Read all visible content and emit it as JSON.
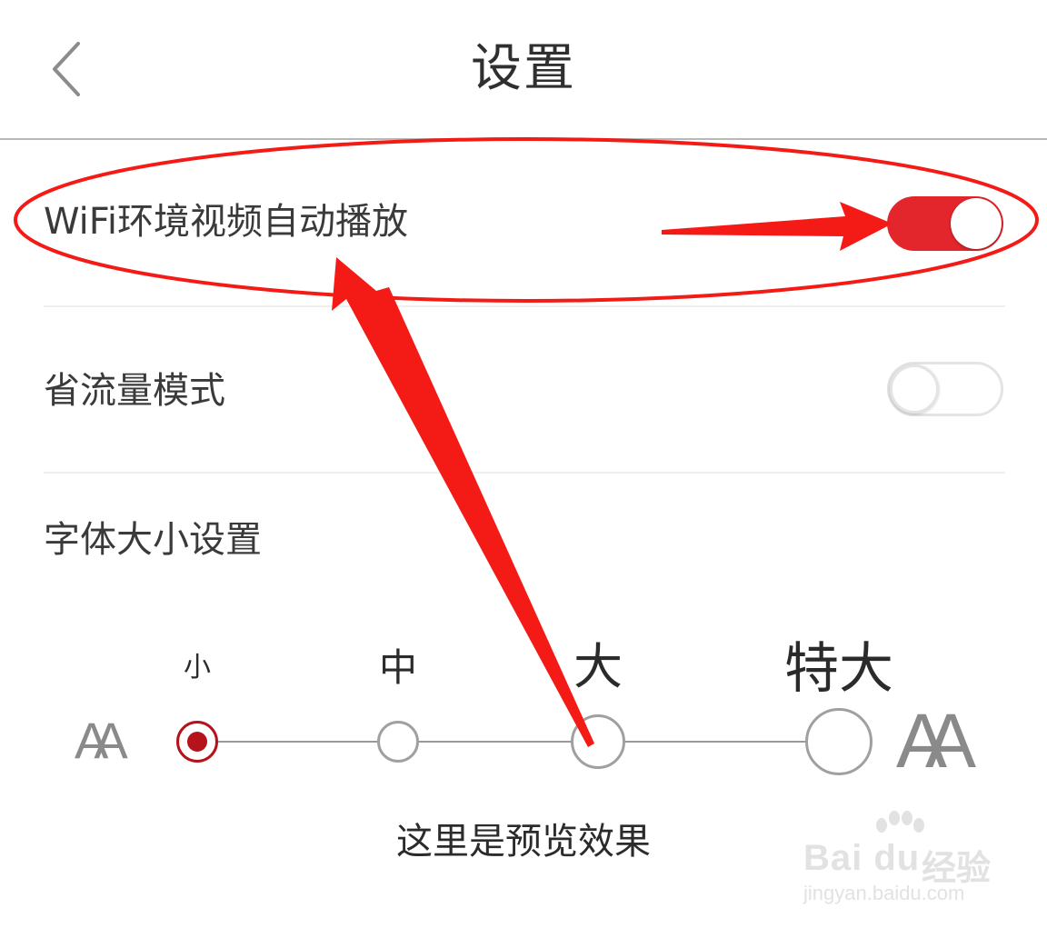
{
  "header": {
    "title": "设置",
    "back_icon": "chevron-left-icon"
  },
  "settings": {
    "wifi_autoplay": {
      "label": "WiFi环境视频自动播放",
      "enabled": true
    },
    "data_saver": {
      "label": "省流量模式",
      "enabled": false
    },
    "font_size": {
      "label": "字体大小设置",
      "options": [
        "小",
        "中",
        "大",
        "特大"
      ],
      "selected": "小",
      "small_icon": "AA",
      "large_icon": "AA"
    }
  },
  "preview": {
    "text": "这里是预览效果"
  },
  "colors": {
    "accent": "#e3262c",
    "selected_dot": "#b5121b",
    "annotation": "#f41b16"
  },
  "watermark": {
    "brand": "Bai du",
    "brand_cn": "经验",
    "url": "jingyan.baidu.com"
  }
}
